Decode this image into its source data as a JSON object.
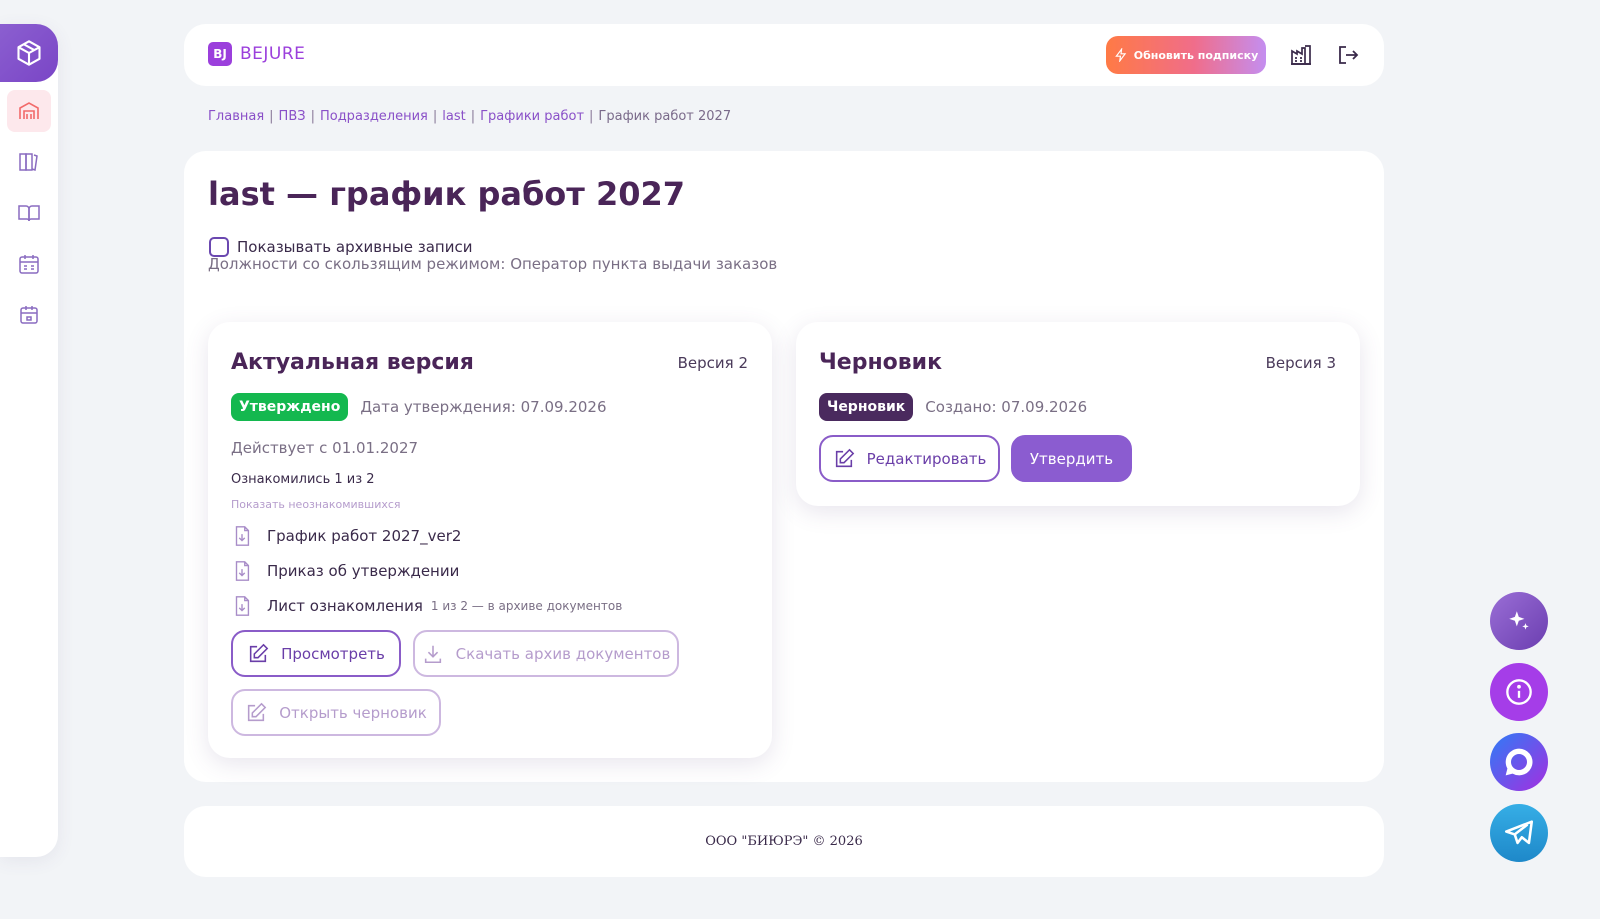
{
  "brand": {
    "mark": "BJ",
    "name": "BEJURE"
  },
  "header": {
    "upgrade_label": "Обновить подписку"
  },
  "sidebar": {
    "items": [
      {
        "name": "warehouse",
        "active": true
      },
      {
        "name": "library",
        "active": false
      },
      {
        "name": "book",
        "active": false
      },
      {
        "name": "calendar-grid",
        "active": false
      },
      {
        "name": "calendar",
        "active": false
      }
    ]
  },
  "breadcrumb": {
    "items": [
      "Главная",
      "ПВЗ",
      "Подразделения",
      "last",
      "Графики работ"
    ],
    "current": "График работ 2027",
    "separator": "|"
  },
  "page": {
    "title": "last — график работ 2027",
    "archive_checkbox_label": "Показывать архивные записи",
    "positions_text": "Должности со скользящим режимом: Оператор пункта выдачи заказов"
  },
  "current_version": {
    "title": "Актуальная версия",
    "version": "Версия 2",
    "status_badge": "Утверждено",
    "approval_date": "Дата утверждения: 07.09.2026",
    "effective_from": "Действует с 01.01.2027",
    "acknowledged": "Ознакомились 1 из 2",
    "show_unacknowledged": "Показать неознакомившихся",
    "documents": [
      {
        "label": "График работ 2027_ver2",
        "note": ""
      },
      {
        "label": "Приказ об утверждении",
        "note": ""
      },
      {
        "label": "Лист ознакомления",
        "note": "1 из 2 — в архиве документов"
      }
    ],
    "view_button": "Просмотреть",
    "download_button": "Скачать архив документов",
    "open_draft_button": "Открыть черновик"
  },
  "draft": {
    "title": "Черновик",
    "version": "Версия 3",
    "status_badge": "Черновик",
    "created": "Создано: 07.09.2026",
    "edit_button": "Редактировать",
    "approve_button": "Утвердить"
  },
  "footer": {
    "text": "ООО \"БИЮРЭ\" © 2026"
  },
  "colors": {
    "accent": "#8b5cd0",
    "approved": "#14b84f",
    "draft_badge": "#4a2a5e",
    "title": "#4a2558"
  }
}
